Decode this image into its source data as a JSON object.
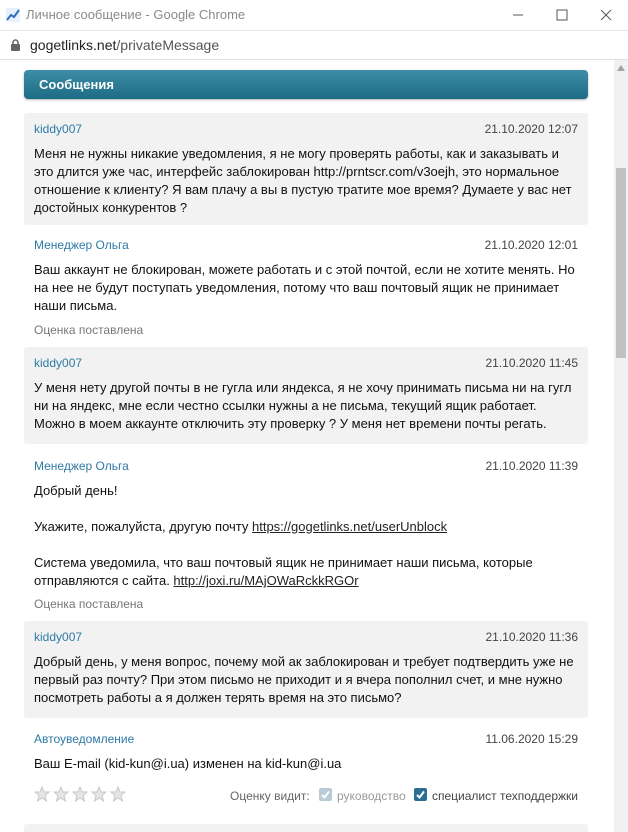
{
  "window": {
    "title": "Личное сообщение - Google Chrome",
    "url_host": "gogetlinks.net",
    "url_path": "/privateMessage"
  },
  "header": {
    "title": "Сообщения"
  },
  "messages": [
    {
      "author": "kiddy007",
      "date": "21.10.2020 12:07",
      "text": "Меня не нужны никакие уведомления, я не могу проверять работы, как и заказывать и это длится уже час, интерфейс заблокирован http://prntscr.com/v3oejh, это нормальное отношение к клиенту? Я вам плачу а вы в пустую тратите мое время? Думаете у вас нет достойных конкурентов ?"
    },
    {
      "author": "Менеджер Ольга",
      "date": "21.10.2020 12:01",
      "text": "Ваш аккаунт не блокирован, можете работать и с этой почтой, если не хотите менять. Но на нее не будут поступать уведомления, потому что ваш почтовый ящик не принимает наши письма.",
      "rated": "Оценка поставлена"
    },
    {
      "author": "kiddy007",
      "date": "21.10.2020 11:45",
      "text": "У меня нету другой почты в не гугла или яндекса, я не хочу принимать письма ни на гугл ни на яндекс, мне если честно ссылки нужны а не письма, текущий ящик работает. Можно в моем аккаунте отключить эту проверку ? У меня нет времени почты регать."
    },
    {
      "author": "Менеджер Ольга",
      "date": "21.10.2020 11:39",
      "greeting": "Добрый день!",
      "line2_text": "Укажите, пожалуйста, другую почту ",
      "line2_link": "https://gogetlinks.net/userUnblock",
      "line3_text": "Система уведомила, что ваш почтовый ящик не принимает наши письма, которые отправляются с сайта. ",
      "line3_link": "http://joxi.ru/MAjOWaRckkRGOr",
      "rated": "Оценка поставлена"
    },
    {
      "author": "kiddy007",
      "date": "21.10.2020 11:36",
      "text": "Добрый день, у меня вопрос, почему мой ак заблокирован и требует подтвердить уже не первый раз почту? При этом письмо не приходит и я вчера пополнил счет, и мне нужно посмотреть работы а я должен терять время на это письмо?"
    },
    {
      "author": "Автоуведомление",
      "date": "11.06.2020 15:29",
      "text": "Ваш E-mail (kid-kun@i.ua) изменен на kid-kun@i.ua"
    }
  ],
  "rating": {
    "stars": 5,
    "visible_label": "Оценку видит:",
    "option_management": "руководство",
    "option_support": "специалист техподдержки",
    "management_checked": true,
    "support_checked": true
  },
  "colors": {
    "header_bg": "#2a7b94",
    "author_link": "#2e7aa6",
    "user_bubble": "#f2f2f2"
  }
}
